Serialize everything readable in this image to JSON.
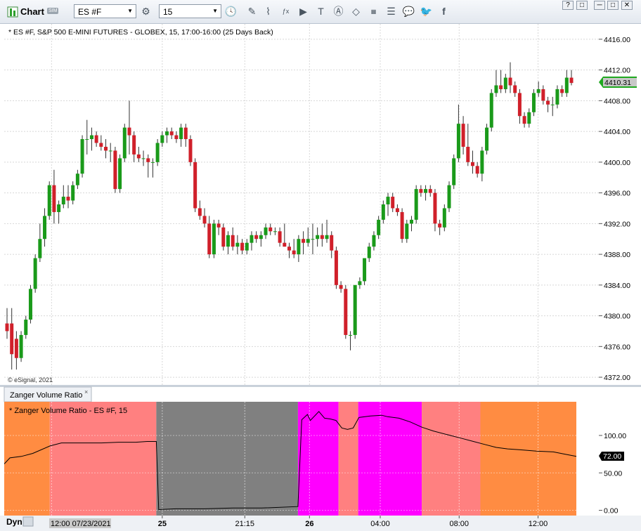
{
  "toolbar": {
    "title": "Chart",
    "badge": "SIM",
    "symbol": "ES #F",
    "interval": "15",
    "window_buttons": [
      "?",
      "□",
      "─",
      "□",
      "✕"
    ]
  },
  "price_pane": {
    "title": "* ES #F, S&P 500 E-MINI FUTURES - GLOBEX, 15, 17:00-16:00 (25 Days Back)",
    "copyright": "© eSignal, 2021",
    "last_price": "4410.31",
    "ticks": [
      "4416.00",
      "4412.00",
      "4408.00",
      "4404.00",
      "4400.00",
      "4396.00",
      "4392.00",
      "4388.00",
      "4384.00",
      "4380.00",
      "4376.00",
      "4372.00"
    ]
  },
  "indicator_pane": {
    "tab": "Zanger Volume Ratio",
    "title": "* Zanger Volume Ratio - ES #F, 15",
    "current_value": "72.00",
    "ticks": [
      "100.00",
      "50.00",
      "0.00"
    ]
  },
  "time_axis": {
    "mode": "Dyn",
    "labels": [
      "12:00 07/23/2021",
      "25",
      "21:15",
      "26",
      "04:00",
      "08:00",
      "12:00"
    ]
  },
  "colors": {
    "up_candle": "#1a9a1a",
    "down_candle": "#d0202a",
    "zone_orange": "#ff8c42",
    "zone_pink": "#ff8080",
    "zone_gray": "#808080",
    "zone_magenta": "#ff00ff",
    "price_marker": "#1fa81f"
  },
  "chart_data": [
    {
      "type": "candlestick",
      "title": "* ES #F, S&P 500 E-MINI FUTURES - GLOBEX, 15, 17:00-16:00 (25 Days Back)",
      "ylim": [
        4371,
        4418
      ],
      "yticks": [
        4372,
        4376,
        4380,
        4384,
        4388,
        4392,
        4396,
        4400,
        4404,
        4408,
        4412,
        4416
      ],
      "x_labels": [
        "12:00 07/23/2021",
        "25",
        "21:15",
        "26",
        "04:00",
        "08:00",
        "12:00"
      ],
      "candles": [
        {
          "o": 4379,
          "h": 4381,
          "l": 4377,
          "c": 4378
        },
        {
          "o": 4379,
          "h": 4381,
          "l": 4373,
          "c": 4375
        },
        {
          "o": 4377,
          "h": 4378,
          "l": 4373,
          "c": 4374.5
        },
        {
          "o": 4374.5,
          "h": 4378,
          "l": 4374,
          "c": 4377.5
        },
        {
          "o": 4377.5,
          "h": 4380,
          "l": 4377,
          "c": 4379.5
        },
        {
          "o": 4379.5,
          "h": 4384,
          "l": 4379,
          "c": 4383.5
        },
        {
          "o": 4383.5,
          "h": 4388,
          "l": 4383,
          "c": 4387.5
        },
        {
          "o": 4387.5,
          "h": 4392,
          "l": 4387,
          "c": 4390
        },
        {
          "o": 4390,
          "h": 4394,
          "l": 4389,
          "c": 4393
        },
        {
          "o": 4393,
          "h": 4397.5,
          "l": 4392.5,
          "c": 4397
        },
        {
          "o": 4397,
          "h": 4399,
          "l": 4392,
          "c": 4393.5
        },
        {
          "o": 4393.5,
          "h": 4395,
          "l": 4392,
          "c": 4394.5
        },
        {
          "o": 4394.5,
          "h": 4397,
          "l": 4394,
          "c": 4395.5
        },
        {
          "o": 4395.5,
          "h": 4397,
          "l": 4394,
          "c": 4395
        },
        {
          "o": 4395,
          "h": 4397.5,
          "l": 4394.5,
          "c": 4397
        },
        {
          "o": 4397,
          "h": 4399,
          "l": 4396.5,
          "c": 4398.5
        },
        {
          "o": 4398.5,
          "h": 4403.5,
          "l": 4398,
          "c": 4403
        },
        {
          "o": 4403,
          "h": 4405.5,
          "l": 4401,
          "c": 4403
        },
        {
          "o": 4403,
          "h": 4404.5,
          "l": 4401.5,
          "c": 4403.5
        },
        {
          "o": 4403.5,
          "h": 4404,
          "l": 4402,
          "c": 4402.5
        },
        {
          "o": 4402.5,
          "h": 4403.5,
          "l": 4401.5,
          "c": 4402
        },
        {
          "o": 4402,
          "h": 4403,
          "l": 4400.5,
          "c": 4401.5
        },
        {
          "o": 4401.5,
          "h": 4402.5,
          "l": 4400,
          "c": 4401.5
        },
        {
          "o": 4401.5,
          "h": 4402,
          "l": 4396,
          "c": 4396.5
        },
        {
          "o": 4396.5,
          "h": 4401,
          "l": 4396,
          "c": 4400.5
        },
        {
          "o": 4400.5,
          "h": 4405,
          "l": 4400,
          "c": 4404.5
        },
        {
          "o": 4404.5,
          "h": 4408,
          "l": 4401,
          "c": 4403.5
        },
        {
          "o": 4403.5,
          "h": 4404,
          "l": 4400,
          "c": 4401
        },
        {
          "o": 4401,
          "h": 4402,
          "l": 4400,
          "c": 4400.5
        },
        {
          "o": 4400.5,
          "h": 4401.5,
          "l": 4399.5,
          "c": 4400.5
        },
        {
          "o": 4400.5,
          "h": 4401,
          "l": 4398,
          "c": 4400
        },
        {
          "o": 4400,
          "h": 4400.5,
          "l": 4398,
          "c": 4400
        },
        {
          "o": 4400,
          "h": 4403,
          "l": 4399.5,
          "c": 4402.5
        },
        {
          "o": 4402.5,
          "h": 4404,
          "l": 4402,
          "c": 4403.5
        },
        {
          "o": 4403.5,
          "h": 4404.5,
          "l": 4402.5,
          "c": 4404
        },
        {
          "o": 4404,
          "h": 4404.5,
          "l": 4403,
          "c": 4403.5
        },
        {
          "o": 4403.5,
          "h": 4404,
          "l": 4402.5,
          "c": 4403
        },
        {
          "o": 4403,
          "h": 4405,
          "l": 4402,
          "c": 4404.5
        },
        {
          "o": 4404.5,
          "h": 4405,
          "l": 4402,
          "c": 4403
        },
        {
          "o": 4403,
          "h": 4403.5,
          "l": 4399.5,
          "c": 4400
        },
        {
          "o": 4400,
          "h": 4400.5,
          "l": 4393.5,
          "c": 4394
        },
        {
          "o": 4394,
          "h": 4395,
          "l": 4392.5,
          "c": 4393
        },
        {
          "o": 4393,
          "h": 4394,
          "l": 4391.5,
          "c": 4392
        },
        {
          "o": 4392,
          "h": 4393,
          "l": 4387.5,
          "c": 4388
        },
        {
          "o": 4388,
          "h": 4392.5,
          "l": 4387.5,
          "c": 4392
        },
        {
          "o": 4392,
          "h": 4392.5,
          "l": 4390.5,
          "c": 4391.5
        },
        {
          "o": 4391.5,
          "h": 4392,
          "l": 4388.5,
          "c": 4389
        },
        {
          "o": 4389,
          "h": 4391,
          "l": 4388,
          "c": 4390.5
        },
        {
          "o": 4390.5,
          "h": 4391.5,
          "l": 4388.5,
          "c": 4389
        },
        {
          "o": 4389,
          "h": 4390.5,
          "l": 4388,
          "c": 4389.5
        },
        {
          "o": 4389.5,
          "h": 4390,
          "l": 4388,
          "c": 4388.5
        },
        {
          "o": 4388.5,
          "h": 4390,
          "l": 4388,
          "c": 4389.5
        },
        {
          "o": 4389.5,
          "h": 4391,
          "l": 4388.5,
          "c": 4390.5
        },
        {
          "o": 4390.5,
          "h": 4391,
          "l": 4389.5,
          "c": 4390
        },
        {
          "o": 4390,
          "h": 4391,
          "l": 4389,
          "c": 4390.5
        },
        {
          "o": 4390.5,
          "h": 4392,
          "l": 4390,
          "c": 4391.5
        },
        {
          "o": 4391.5,
          "h": 4392,
          "l": 4390.5,
          "c": 4391
        },
        {
          "o": 4391,
          "h": 4391.5,
          "l": 4390.5,
          "c": 4391
        },
        {
          "o": 4391,
          "h": 4391.5,
          "l": 4389,
          "c": 4389.5
        },
        {
          "o": 4389.5,
          "h": 4392,
          "l": 4389,
          "c": 4389
        },
        {
          "o": 4389,
          "h": 4389.5,
          "l": 4387.5,
          "c": 4388.5
        },
        {
          "o": 4388.5,
          "h": 4390,
          "l": 4387.5,
          "c": 4388
        },
        {
          "o": 4388,
          "h": 4390.5,
          "l": 4387,
          "c": 4390
        },
        {
          "o": 4390,
          "h": 4391,
          "l": 4388,
          "c": 4389.5
        },
        {
          "o": 4389.5,
          "h": 4391.5,
          "l": 4389,
          "c": 4390
        },
        {
          "o": 4390,
          "h": 4392,
          "l": 4388,
          "c": 4390
        },
        {
          "o": 4390,
          "h": 4391.5,
          "l": 4389,
          "c": 4390.5
        },
        {
          "o": 4390.5,
          "h": 4392,
          "l": 4389,
          "c": 4390
        },
        {
          "o": 4390,
          "h": 4392.5,
          "l": 4389.5,
          "c": 4390.5
        },
        {
          "o": 4390.5,
          "h": 4391,
          "l": 4387.5,
          "c": 4388.5
        },
        {
          "o": 4388.5,
          "h": 4389,
          "l": 4383.5,
          "c": 4384
        },
        {
          "o": 4384,
          "h": 4384.5,
          "l": 4383,
          "c": 4383.5
        },
        {
          "o": 4383.5,
          "h": 4384,
          "l": 4377,
          "c": 4377.5
        },
        {
          "o": 4377.5,
          "h": 4378,
          "l": 4375.5,
          "c": 4377.5
        },
        {
          "o": 4377.5,
          "h": 4384,
          "l": 4377,
          "c": 4384
        },
        {
          "o": 4384,
          "h": 4385,
          "l": 4383.5,
          "c": 4384.5
        },
        {
          "o": 4384.5,
          "h": 4387.5,
          "l": 4384,
          "c": 4387.5
        },
        {
          "o": 4387.5,
          "h": 4389.5,
          "l": 4387,
          "c": 4389
        },
        {
          "o": 4389,
          "h": 4391,
          "l": 4388.5,
          "c": 4390.5
        },
        {
          "o": 4390.5,
          "h": 4393,
          "l": 4390,
          "c": 4392.5
        },
        {
          "o": 4392.5,
          "h": 4395,
          "l": 4392,
          "c": 4394.5
        },
        {
          "o": 4394.5,
          "h": 4396,
          "l": 4393,
          "c": 4395.5
        },
        {
          "o": 4395.5,
          "h": 4396,
          "l": 4393.5,
          "c": 4394
        },
        {
          "o": 4394,
          "h": 4394.5,
          "l": 4393,
          "c": 4393.5
        },
        {
          "o": 4393.5,
          "h": 4394,
          "l": 4389.5,
          "c": 4390
        },
        {
          "o": 4390,
          "h": 4392.5,
          "l": 4389.5,
          "c": 4392
        },
        {
          "o": 4392,
          "h": 4393,
          "l": 4391,
          "c": 4392.5
        },
        {
          "o": 4392.5,
          "h": 4397,
          "l": 4392,
          "c": 4396.5
        },
        {
          "o": 4396.5,
          "h": 4397,
          "l": 4395.5,
          "c": 4396
        },
        {
          "o": 4396,
          "h": 4397,
          "l": 4395,
          "c": 4396.5
        },
        {
          "o": 4396.5,
          "h": 4397,
          "l": 4395.5,
          "c": 4396
        },
        {
          "o": 4396,
          "h": 4396.5,
          "l": 4391,
          "c": 4392
        },
        {
          "o": 4392,
          "h": 4392.5,
          "l": 4390.5,
          "c": 4391.5
        },
        {
          "o": 4391.5,
          "h": 4394.5,
          "l": 4391,
          "c": 4394
        },
        {
          "o": 4394,
          "h": 4397.5,
          "l": 4393.5,
          "c": 4397
        },
        {
          "o": 4397,
          "h": 4401,
          "l": 4396.5,
          "c": 4400.5
        },
        {
          "o": 4400.5,
          "h": 4407.5,
          "l": 4400,
          "c": 4405
        },
        {
          "o": 4405,
          "h": 4406,
          "l": 4401,
          "c": 4402
        },
        {
          "o": 4402,
          "h": 4405,
          "l": 4399.5,
          "c": 4400
        },
        {
          "o": 4400,
          "h": 4401.5,
          "l": 4398.5,
          "c": 4399.5
        },
        {
          "o": 4399.5,
          "h": 4400,
          "l": 4398,
          "c": 4398.5
        },
        {
          "o": 4398.5,
          "h": 4402,
          "l": 4397.5,
          "c": 4401.5
        },
        {
          "o": 4401.5,
          "h": 4405,
          "l": 4401,
          "c": 4404.5
        },
        {
          "o": 4404.5,
          "h": 4409.5,
          "l": 4404,
          "c": 4409
        },
        {
          "o": 4409,
          "h": 4412,
          "l": 4408.5,
          "c": 4410
        },
        {
          "o": 4410,
          "h": 4412,
          "l": 4409,
          "c": 4409.5
        },
        {
          "o": 4409.5,
          "h": 4411.5,
          "l": 4409,
          "c": 4411
        },
        {
          "o": 4411,
          "h": 4413,
          "l": 4409,
          "c": 4410
        },
        {
          "o": 4410,
          "h": 4410.5,
          "l": 4408.5,
          "c": 4409
        },
        {
          "o": 4409,
          "h": 4409.5,
          "l": 4405,
          "c": 4406
        },
        {
          "o": 4406,
          "h": 4406.5,
          "l": 4404.5,
          "c": 4405
        },
        {
          "o": 4405,
          "h": 4407,
          "l": 4404.5,
          "c": 4406.5
        },
        {
          "o": 4406.5,
          "h": 4409.5,
          "l": 4406,
          "c": 4409
        },
        {
          "o": 4409,
          "h": 4410.5,
          "l": 4408.5,
          "c": 4409.5
        },
        {
          "o": 4409.5,
          "h": 4410,
          "l": 4407.5,
          "c": 4408
        },
        {
          "o": 4408,
          "h": 4408.5,
          "l": 4406.5,
          "c": 4407.5
        },
        {
          "o": 4407.5,
          "h": 4408.5,
          "l": 4406,
          "c": 4407.5
        },
        {
          "o": 4407.5,
          "h": 4410,
          "l": 4407,
          "c": 4409.5
        },
        {
          "o": 4409.5,
          "h": 4410,
          "l": 4408.5,
          "c": 4409
        },
        {
          "o": 4409,
          "h": 4412,
          "l": 4408.5,
          "c": 4411
        },
        {
          "o": 4411,
          "h": 4412,
          "l": 4410,
          "c": 4410.31
        }
      ]
    },
    {
      "type": "area",
      "title": "* Zanger Volume Ratio - ES #F, 15",
      "ylim": [
        -7,
        145
      ],
      "yticks": [
        0,
        50,
        100
      ],
      "zones": [
        {
          "from": 0,
          "to": 0.0796,
          "color": "orange"
        },
        {
          "from": 0.0796,
          "to": 0.2658,
          "color": "pink"
        },
        {
          "from": 0.2658,
          "to": 0.5134,
          "color": "gray"
        },
        {
          "from": 0.5134,
          "to": 0.5843,
          "color": "magenta"
        },
        {
          "from": 0.5843,
          "to": 0.6187,
          "color": "pink"
        },
        {
          "from": 0.6187,
          "to": 0.7298,
          "color": "magenta"
        },
        {
          "from": 0.7298,
          "to": 0.8323,
          "color": "pink"
        },
        {
          "from": 0.8323,
          "to": 1,
          "color": "orange"
        }
      ],
      "line": [
        [
          0,
          62
        ],
        [
          0.01,
          70
        ],
        [
          0.03,
          72
        ],
        [
          0.05,
          76
        ],
        [
          0.08,
          86
        ],
        [
          0.1,
          90
        ],
        [
          0.13,
          90
        ],
        [
          0.17,
          90
        ],
        [
          0.2,
          91
        ],
        [
          0.23,
          91
        ],
        [
          0.25,
          92
        ],
        [
          0.2658,
          92
        ],
        [
          0.27,
          1
        ],
        [
          0.3,
          2
        ],
        [
          0.35,
          2
        ],
        [
          0.4,
          3
        ],
        [
          0.45,
          3
        ],
        [
          0.5134,
          5
        ],
        [
          0.52,
          121
        ],
        [
          0.53,
          128
        ],
        [
          0.535,
          120
        ],
        [
          0.55,
          132
        ],
        [
          0.56,
          123
        ],
        [
          0.57,
          122
        ],
        [
          0.58,
          120
        ],
        [
          0.59,
          110
        ],
        [
          0.6,
          108
        ],
        [
          0.61,
          110
        ],
        [
          0.62,
          124
        ],
        [
          0.64,
          126
        ],
        [
          0.66,
          127
        ],
        [
          0.67,
          125
        ],
        [
          0.69,
          123
        ],
        [
          0.71,
          118
        ],
        [
          0.73,
          111
        ],
        [
          0.75,
          106
        ],
        [
          0.78,
          100
        ],
        [
          0.8,
          96
        ],
        [
          0.82,
          92
        ],
        [
          0.84,
          88
        ],
        [
          0.86,
          84
        ],
        [
          0.88,
          82
        ],
        [
          0.9,
          81
        ],
        [
          0.93,
          79
        ],
        [
          0.96,
          78
        ],
        [
          0.98,
          75
        ],
        [
          1,
          72
        ]
      ]
    }
  ]
}
